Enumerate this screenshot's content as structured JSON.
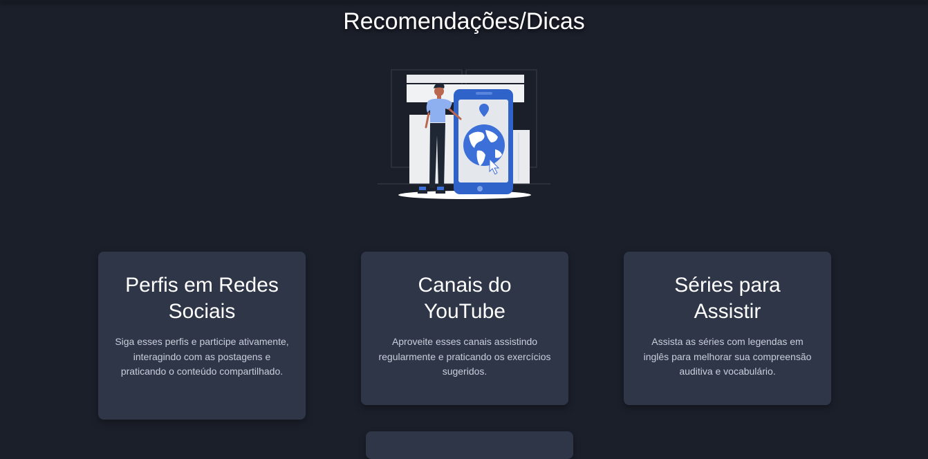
{
  "page": {
    "title": "Recomendações/Dicas"
  },
  "illustration": {
    "icon": "person-with-phone-globe-illustration"
  },
  "cards": [
    {
      "title": "Perfis em Redes Sociais",
      "description": "Siga esses perfis e participe ativamente, interagindo com as postagens e praticando o conteúdo compartilhado."
    },
    {
      "title": "Canais do YouTube",
      "description": "Aproveite esses canais assistindo regularmente e praticando os exercícios sugeridos."
    },
    {
      "title": "Séries para Assistir",
      "description": "Assista as séries com legendas em inglês para melhorar sua compreensão auditiva e vocabulário."
    }
  ],
  "colors": {
    "background": "#1b1f2a",
    "card": "#2e3648",
    "accent": "#3d6fd9",
    "text": "#ffffff",
    "muted_text": "#c9cfdb"
  }
}
